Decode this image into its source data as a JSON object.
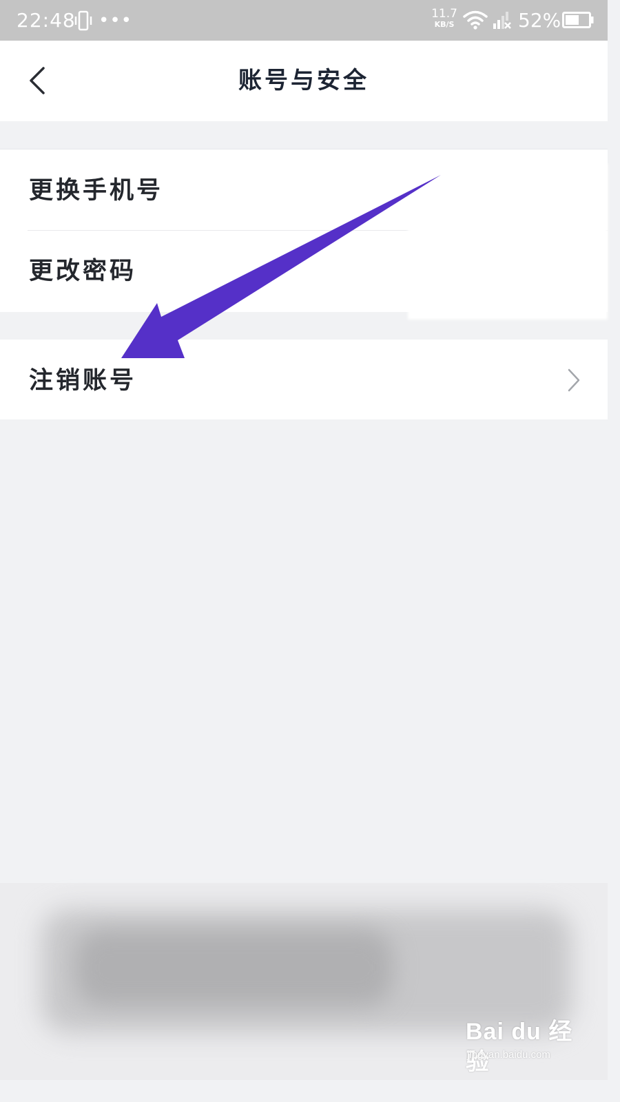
{
  "status_bar": {
    "time": "22:48",
    "dots": "•••",
    "net_speed_value": "11.7",
    "net_speed_unit": "KB/S",
    "battery_percent": "52%",
    "icons": [
      "vibrate-icon",
      "wifi-icon",
      "signal-icon",
      "battery-icon"
    ]
  },
  "nav": {
    "title": "账号与安全",
    "back_icon": "chevron-left-icon"
  },
  "settings": {
    "group1": [
      {
        "label": "更换手机号"
      },
      {
        "label": "更改密码"
      }
    ],
    "group2": [
      {
        "label": "注销账号",
        "icon": "chevron-right-icon"
      }
    ]
  },
  "annotation": {
    "arrow_color": "#5530c8"
  },
  "watermark": {
    "main": "Bai du 经验",
    "sub": "jingyan.baidu.com"
  },
  "colors": {
    "status_bar_bg": "#c4c4c4",
    "page_bg": "#f1f2f4",
    "text": "#24272d",
    "title": "#1c2433"
  }
}
